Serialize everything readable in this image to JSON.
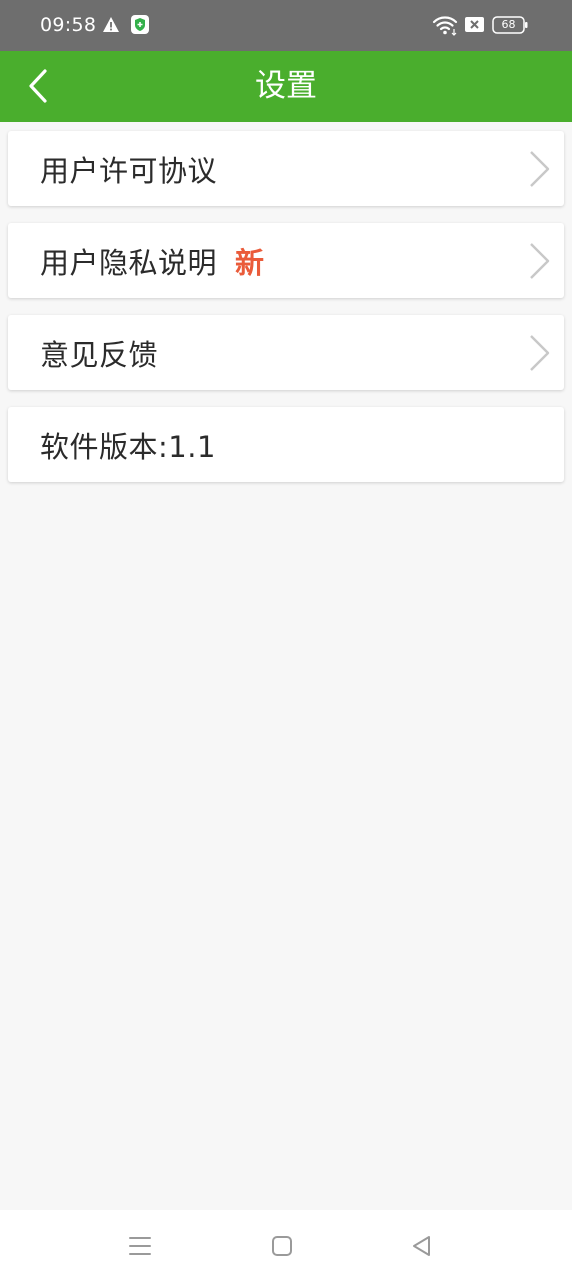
{
  "status_bar": {
    "time": "09:58",
    "battery": "68",
    "icons": [
      "warning-icon",
      "shield-icon",
      "wifi-icon",
      "sim-off-icon",
      "battery-icon"
    ]
  },
  "app_bar": {
    "title": "设置",
    "back_icon": "chevron-left-icon",
    "color": "#4aae2d"
  },
  "menu": {
    "items": [
      {
        "label": "用户许可协议",
        "badge": "",
        "has_arrow": true
      },
      {
        "label": "用户隐私说明",
        "badge": "新",
        "has_arrow": true
      },
      {
        "label": "意见反馈",
        "badge": "",
        "has_arrow": true
      },
      {
        "label": "软件版本:1.1",
        "badge": "",
        "has_arrow": false
      }
    ],
    "badge_color": "#ea5b3a"
  },
  "nav_bar": {
    "icons": [
      "menu-icon",
      "home-icon",
      "back-icon"
    ]
  }
}
